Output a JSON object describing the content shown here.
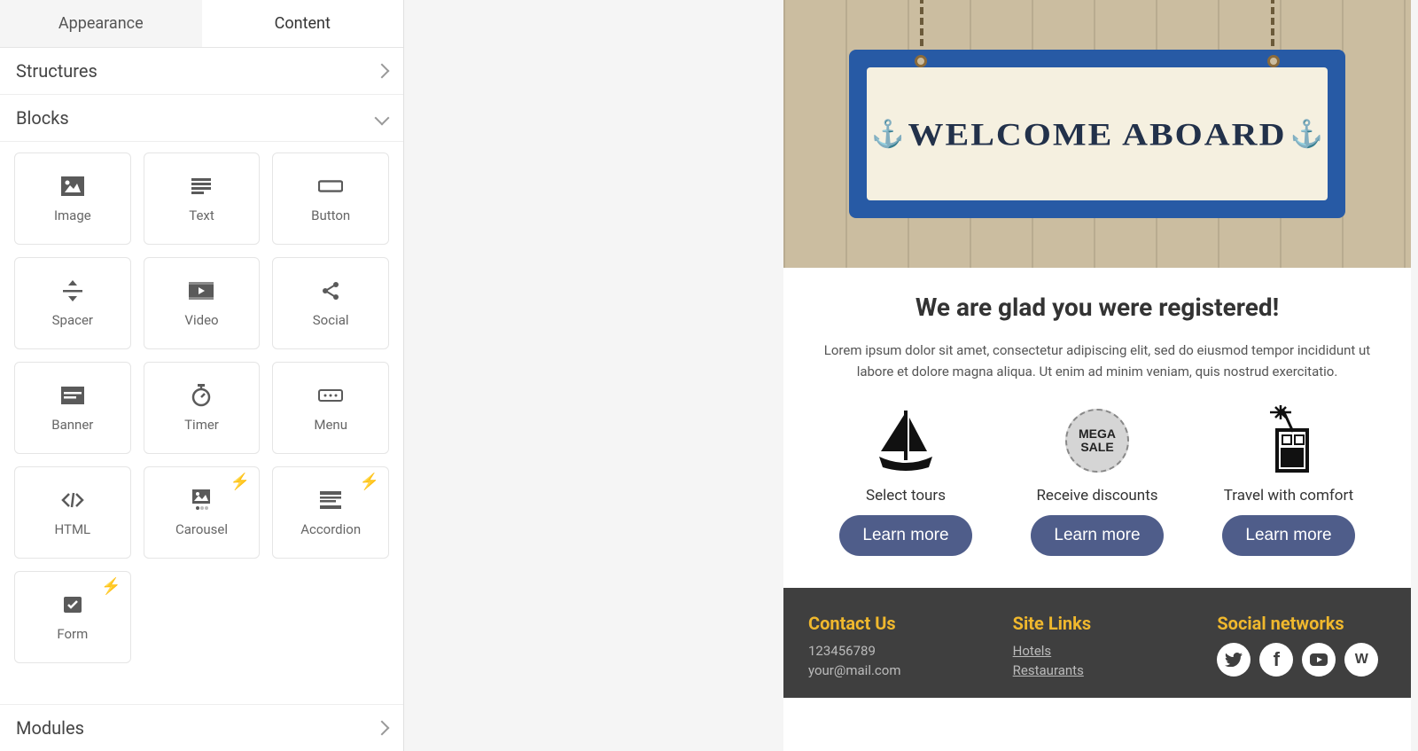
{
  "tabs": {
    "appearance": "Appearance",
    "content": "Content"
  },
  "sections": {
    "structures": "Structures",
    "blocks": "Blocks",
    "modules": "Modules"
  },
  "blocks": {
    "image": "Image",
    "text": "Text",
    "button": "Button",
    "spacer": "Spacer",
    "video": "Video",
    "social": "Social",
    "banner": "Banner",
    "timer": "Timer",
    "menu": "Menu",
    "html": "HTML",
    "carousel": "Carousel",
    "accordion": "Accordion",
    "form": "Form"
  },
  "hero": {
    "sign_text": "WELCOME ABOARD"
  },
  "content_section": {
    "headline": "We are glad you were registered!",
    "body": "Lorem ipsum dolor sit amet, consectetur adipiscing elit, sed do eiusmod tempor incididunt ut labore et dolore magna aliqua. Ut enim ad minim veniam, quis nostrud exercitatio."
  },
  "features": {
    "f1": {
      "label": "Select tours",
      "cta": "Learn more"
    },
    "f2": {
      "label": "Receive discounts",
      "cta": "Learn more",
      "badge_top": "MEGA",
      "badge_bottom": "SALE"
    },
    "f3": {
      "label": "Travel with comfort",
      "cta": "Learn more"
    }
  },
  "footer": {
    "contact": {
      "title": "Contact Us",
      "phone": "123456789",
      "email": "your@mail.com"
    },
    "links": {
      "title": "Site Links",
      "l1": "Hotels",
      "l2": "Restaurants"
    },
    "social": {
      "title": "Social networks"
    }
  }
}
